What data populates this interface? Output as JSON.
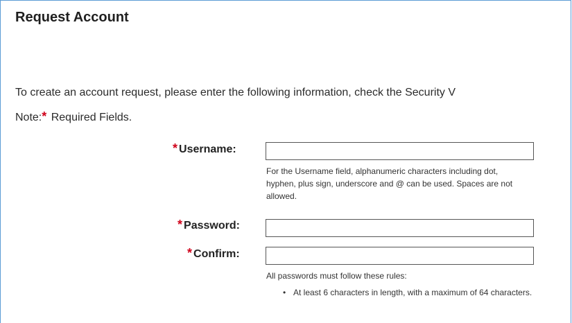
{
  "page": {
    "title": "Request Account",
    "intro_text": "To create an account request, please enter the following information, check the Security V",
    "note_prefix": "Note:",
    "required_star": "*",
    "note_suffix": " Required Fields."
  },
  "form": {
    "username": {
      "label": "Username:",
      "value": "",
      "help_text": "For the Username field, alphanumeric characters including dot, hyphen, plus sign, underscore and @ can be used. Spaces are not allowed."
    },
    "password": {
      "label": "Password:",
      "value": ""
    },
    "confirm": {
      "label": "Confirm:",
      "value": ""
    },
    "password_rules": {
      "heading": "All passwords must follow these rules:",
      "bullet": "•",
      "items": [
        "At least 6 characters in length, with a maximum of 64 characters."
      ]
    }
  },
  "colors": {
    "required_star": "#d0021b",
    "frame_border": "#5b9bd5"
  }
}
